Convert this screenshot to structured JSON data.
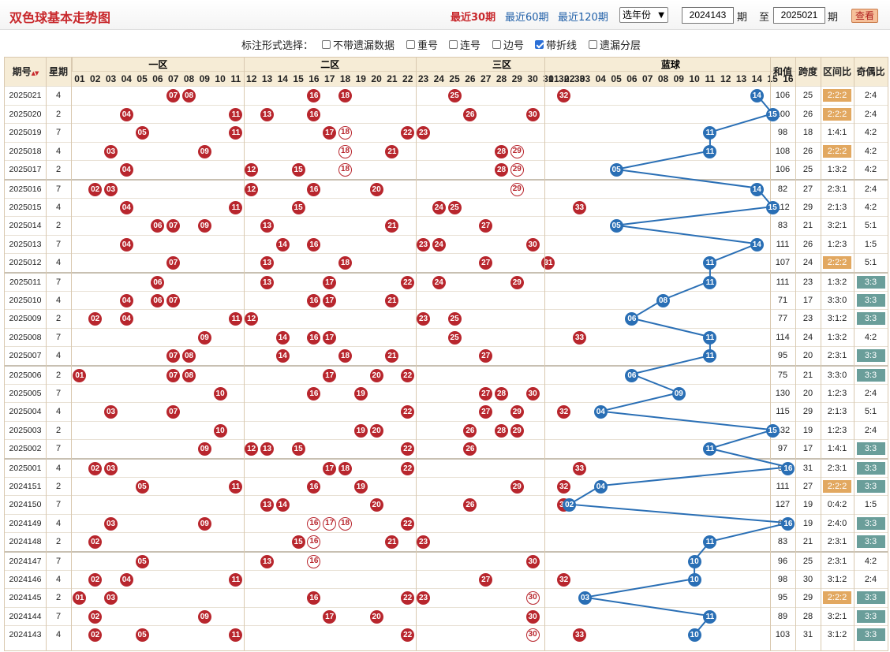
{
  "header": {
    "title": "双色球基本走势图",
    "nav": [
      "最近30期",
      "最近60期",
      "最近120期"
    ],
    "nav_active": 0,
    "year_select": "选年份",
    "from_issue": "2024143",
    "from_label": "期",
    "to_label": "至",
    "to_issue": "2025021",
    "to_suffix": "期",
    "query_button": "查看"
  },
  "options": {
    "title": "标注形式选择：",
    "items": [
      {
        "label": "不带遗漏数据",
        "checked": false
      },
      {
        "label": "重号",
        "checked": false
      },
      {
        "label": "连号",
        "checked": false
      },
      {
        "label": "边号",
        "checked": false
      },
      {
        "label": "带折线",
        "checked": true
      },
      {
        "label": "遗漏分层",
        "checked": false
      }
    ]
  },
  "table": {
    "col_issue": "期号",
    "col_week": "星期",
    "zones": [
      "一区",
      "二区",
      "三区",
      "蓝球"
    ],
    "col_sum": "和值",
    "col_span": "跨度",
    "col_ratio": "区间比",
    "col_oe": "奇偶比",
    "red_numbers": [
      "01",
      "02",
      "03",
      "04",
      "05",
      "06",
      "07",
      "08",
      "09",
      "10",
      "11",
      "12",
      "13",
      "14",
      "15",
      "16",
      "17",
      "18",
      "19",
      "20",
      "21",
      "22",
      "23",
      "24",
      "25",
      "26",
      "27",
      "28",
      "29",
      "30",
      "31",
      "32",
      "33"
    ],
    "blue_numbers": [
      "01",
      "02",
      "03",
      "04",
      "05",
      "06",
      "07",
      "08",
      "09",
      "10",
      "11",
      "12",
      "13",
      "14",
      "15",
      "16"
    ],
    "rows": [
      {
        "issue": "2025021",
        "week": "4",
        "reds": [
          7,
          8,
          16,
          18,
          25,
          32
        ],
        "rings": [],
        "blue": 14,
        "sum": "106",
        "span": "25",
        "ratio": "2:2:2",
        "ratio_hl": true,
        "oe": "2:4",
        "oe_hl": false
      },
      {
        "issue": "2025020",
        "week": "2",
        "reds": [
          4,
          11,
          13,
          16,
          26,
          30
        ],
        "rings": [],
        "blue": 15,
        "sum": "100",
        "span": "26",
        "ratio": "2:2:2",
        "ratio_hl": true,
        "oe": "2:4",
        "oe_hl": false
      },
      {
        "issue": "2025019",
        "week": "7",
        "reds": [
          5,
          11,
          17,
          22,
          23
        ],
        "rings": [
          18
        ],
        "blue": 11,
        "sum": "98",
        "span": "18",
        "ratio": "1:4:1",
        "ratio_hl": false,
        "oe": "4:2",
        "oe_hl": false
      },
      {
        "issue": "2025018",
        "week": "4",
        "reds": [
          3,
          9,
          21,
          28
        ],
        "rings": [
          18,
          29
        ],
        "blue": 11,
        "sum": "108",
        "span": "26",
        "ratio": "2:2:2",
        "ratio_hl": true,
        "oe": "4:2",
        "oe_hl": false
      },
      {
        "issue": "2025017",
        "week": "2",
        "reds": [
          4,
          12,
          15,
          28
        ],
        "rings": [
          18,
          29
        ],
        "blue": 5,
        "sum": "106",
        "span": "25",
        "ratio": "1:3:2",
        "ratio_hl": false,
        "oe": "4:2",
        "oe_hl": false
      },
      {
        "issue": "2025016",
        "week": "7",
        "reds": [
          2,
          3,
          12,
          16,
          20
        ],
        "rings": [
          29
        ],
        "blue": 14,
        "sum": "82",
        "span": "27",
        "ratio": "2:3:1",
        "ratio_hl": false,
        "oe": "2:4",
        "oe_hl": false
      },
      {
        "issue": "2025015",
        "week": "4",
        "reds": [
          4,
          11,
          15,
          24,
          25,
          33
        ],
        "rings": [],
        "blue": 15,
        "sum": "112",
        "span": "29",
        "ratio": "2:1:3",
        "ratio_hl": false,
        "oe": "4:2",
        "oe_hl": false
      },
      {
        "issue": "2025014",
        "week": "2",
        "reds": [
          6,
          7,
          9,
          13,
          21,
          27
        ],
        "rings": [],
        "blue": 5,
        "sum": "83",
        "span": "21",
        "ratio": "3:2:1",
        "ratio_hl": false,
        "oe": "5:1",
        "oe_hl": false
      },
      {
        "issue": "2025013",
        "week": "7",
        "reds": [
          4,
          14,
          16,
          23,
          24,
          30
        ],
        "rings": [],
        "blue": 14,
        "sum": "111",
        "span": "26",
        "ratio": "1:2:3",
        "ratio_hl": false,
        "oe": "1:5",
        "oe_hl": false
      },
      {
        "issue": "2025012",
        "week": "4",
        "reds": [
          7,
          13,
          18,
          27,
          31
        ],
        "rings": [],
        "blue": 11,
        "sum": "107",
        "span": "24",
        "ratio": "2:2:2",
        "ratio_hl": true,
        "oe": "5:1",
        "oe_hl": false
      },
      {
        "issue": "2025011",
        "week": "7",
        "reds": [
          6,
          13,
          17,
          22,
          24,
          29
        ],
        "rings": [],
        "blue": 11,
        "sum": "111",
        "span": "23",
        "ratio": "1:3:2",
        "ratio_hl": false,
        "oe": "3:3",
        "oe_hl": true
      },
      {
        "issue": "2025010",
        "week": "4",
        "reds": [
          4,
          6,
          7,
          16,
          17,
          21
        ],
        "rings": [],
        "blue": 8,
        "sum": "71",
        "span": "17",
        "ratio": "3:3:0",
        "ratio_hl": false,
        "oe": "3:3",
        "oe_hl": true
      },
      {
        "issue": "2025009",
        "week": "2",
        "reds": [
          2,
          4,
          11,
          12,
          23,
          25
        ],
        "rings": [],
        "blue": 6,
        "sum": "77",
        "span": "23",
        "ratio": "3:1:2",
        "ratio_hl": false,
        "oe": "3:3",
        "oe_hl": true
      },
      {
        "issue": "2025008",
        "week": "7",
        "reds": [
          9,
          14,
          16,
          17,
          25,
          33
        ],
        "rings": [],
        "blue": 11,
        "sum": "114",
        "span": "24",
        "ratio": "1:3:2",
        "ratio_hl": false,
        "oe": "4:2",
        "oe_hl": false
      },
      {
        "issue": "2025007",
        "week": "4",
        "reds": [
          7,
          8,
          14,
          18,
          21,
          27
        ],
        "rings": [],
        "blue": 11,
        "sum": "95",
        "span": "20",
        "ratio": "2:3:1",
        "ratio_hl": false,
        "oe": "3:3",
        "oe_hl": true
      },
      {
        "issue": "2025006",
        "week": "2",
        "reds": [
          1,
          7,
          8,
          17,
          20,
          22
        ],
        "rings": [],
        "blue": 6,
        "sum": "75",
        "span": "21",
        "ratio": "3:3:0",
        "ratio_hl": false,
        "oe": "3:3",
        "oe_hl": true
      },
      {
        "issue": "2025005",
        "week": "7",
        "reds": [
          10,
          16,
          19,
          27,
          28,
          30
        ],
        "rings": [],
        "blue": 9,
        "sum": "130",
        "span": "20",
        "ratio": "1:2:3",
        "ratio_hl": false,
        "oe": "2:4",
        "oe_hl": false
      },
      {
        "issue": "2025004",
        "week": "4",
        "reds": [
          3,
          7,
          22,
          27,
          29,
          32
        ],
        "rings": [],
        "blue": 4,
        "sum": "115",
        "span": "29",
        "ratio": "2:1:3",
        "ratio_hl": false,
        "oe": "5:1",
        "oe_hl": false
      },
      {
        "issue": "2025003",
        "week": "2",
        "reds": [
          10,
          19,
          20,
          26,
          28,
          29
        ],
        "rings": [],
        "blue": 15,
        "sum": "132",
        "span": "19",
        "ratio": "1:2:3",
        "ratio_hl": false,
        "oe": "2:4",
        "oe_hl": false
      },
      {
        "issue": "2025002",
        "week": "7",
        "reds": [
          9,
          12,
          13,
          15,
          22,
          26
        ],
        "rings": [],
        "blue": 11,
        "sum": "97",
        "span": "17",
        "ratio": "1:4:1",
        "ratio_hl": false,
        "oe": "3:3",
        "oe_hl": true
      },
      {
        "issue": "2025001",
        "week": "4",
        "reds": [
          2,
          3,
          17,
          18,
          22,
          33
        ],
        "rings": [],
        "blue": 16,
        "sum": "95",
        "span": "31",
        "ratio": "2:3:1",
        "ratio_hl": false,
        "oe": "3:3",
        "oe_hl": true
      },
      {
        "issue": "2024151",
        "week": "2",
        "reds": [
          5,
          11,
          16,
          19,
          29,
          32
        ],
        "rings": [],
        "blue": 4,
        "sum": "111",
        "span": "27",
        "ratio": "2:2:2",
        "ratio_hl": true,
        "oe": "3:3",
        "oe_hl": true
      },
      {
        "issue": "2024150",
        "week": "7",
        "reds": [
          13,
          14,
          20,
          26,
          32
        ],
        "rings": [],
        "blue": 2,
        "sum": "127",
        "span": "19",
        "ratio": "0:4:2",
        "ratio_hl": false,
        "oe": "1:5",
        "oe_hl": false
      },
      {
        "issue": "2024149",
        "week": "4",
        "reds": [
          3,
          9,
          22
        ],
        "rings": [
          16,
          17,
          18
        ],
        "blue": 16,
        "sum": "85",
        "span": "19",
        "ratio": "2:4:0",
        "ratio_hl": false,
        "oe": "3:3",
        "oe_hl": true
      },
      {
        "issue": "2024148",
        "week": "2",
        "reds": [
          2,
          15,
          21,
          23
        ],
        "rings": [
          16
        ],
        "blue": 11,
        "sum": "83",
        "span": "21",
        "ratio": "2:3:1",
        "ratio_hl": false,
        "oe": "3:3",
        "oe_hl": true
      },
      {
        "issue": "2024147",
        "week": "7",
        "reds": [
          5,
          13,
          30
        ],
        "rings": [
          16
        ],
        "blue": 10,
        "sum": "96",
        "span": "25",
        "ratio": "2:3:1",
        "ratio_hl": false,
        "oe": "4:2",
        "oe_hl": false
      },
      {
        "issue": "2024146",
        "week": "4",
        "reds": [
          2,
          4,
          11,
          27,
          32
        ],
        "rings": [],
        "blue": 10,
        "sum": "98",
        "span": "30",
        "ratio": "3:1:2",
        "ratio_hl": false,
        "oe": "2:4",
        "oe_hl": false
      },
      {
        "issue": "2024145",
        "week": "2",
        "reds": [
          1,
          3,
          16,
          22,
          23
        ],
        "rings": [
          30
        ],
        "blue": 3,
        "sum": "95",
        "span": "29",
        "ratio": "2:2:2",
        "ratio_hl": true,
        "oe": "3:3",
        "oe_hl": true
      },
      {
        "issue": "2024144",
        "week": "7",
        "reds": [
          2,
          9,
          17,
          20,
          30
        ],
        "rings": [],
        "blue": 11,
        "sum": "89",
        "span": "28",
        "ratio": "3:2:1",
        "ratio_hl": false,
        "oe": "3:3",
        "oe_hl": true
      },
      {
        "issue": "2024143",
        "week": "4",
        "reds": [
          2,
          5,
          11,
          22,
          33
        ],
        "rings": [
          30
        ],
        "blue": 10,
        "sum": "103",
        "span": "31",
        "ratio": "3:1:2",
        "ratio_hl": false,
        "oe": "3:3",
        "oe_hl": true
      }
    ]
  },
  "colors": {
    "red_ball": "#b8262d",
    "blue_ball": "#2a6fb5",
    "header_bg": "#f6ecd6",
    "title": "#c8282c"
  }
}
